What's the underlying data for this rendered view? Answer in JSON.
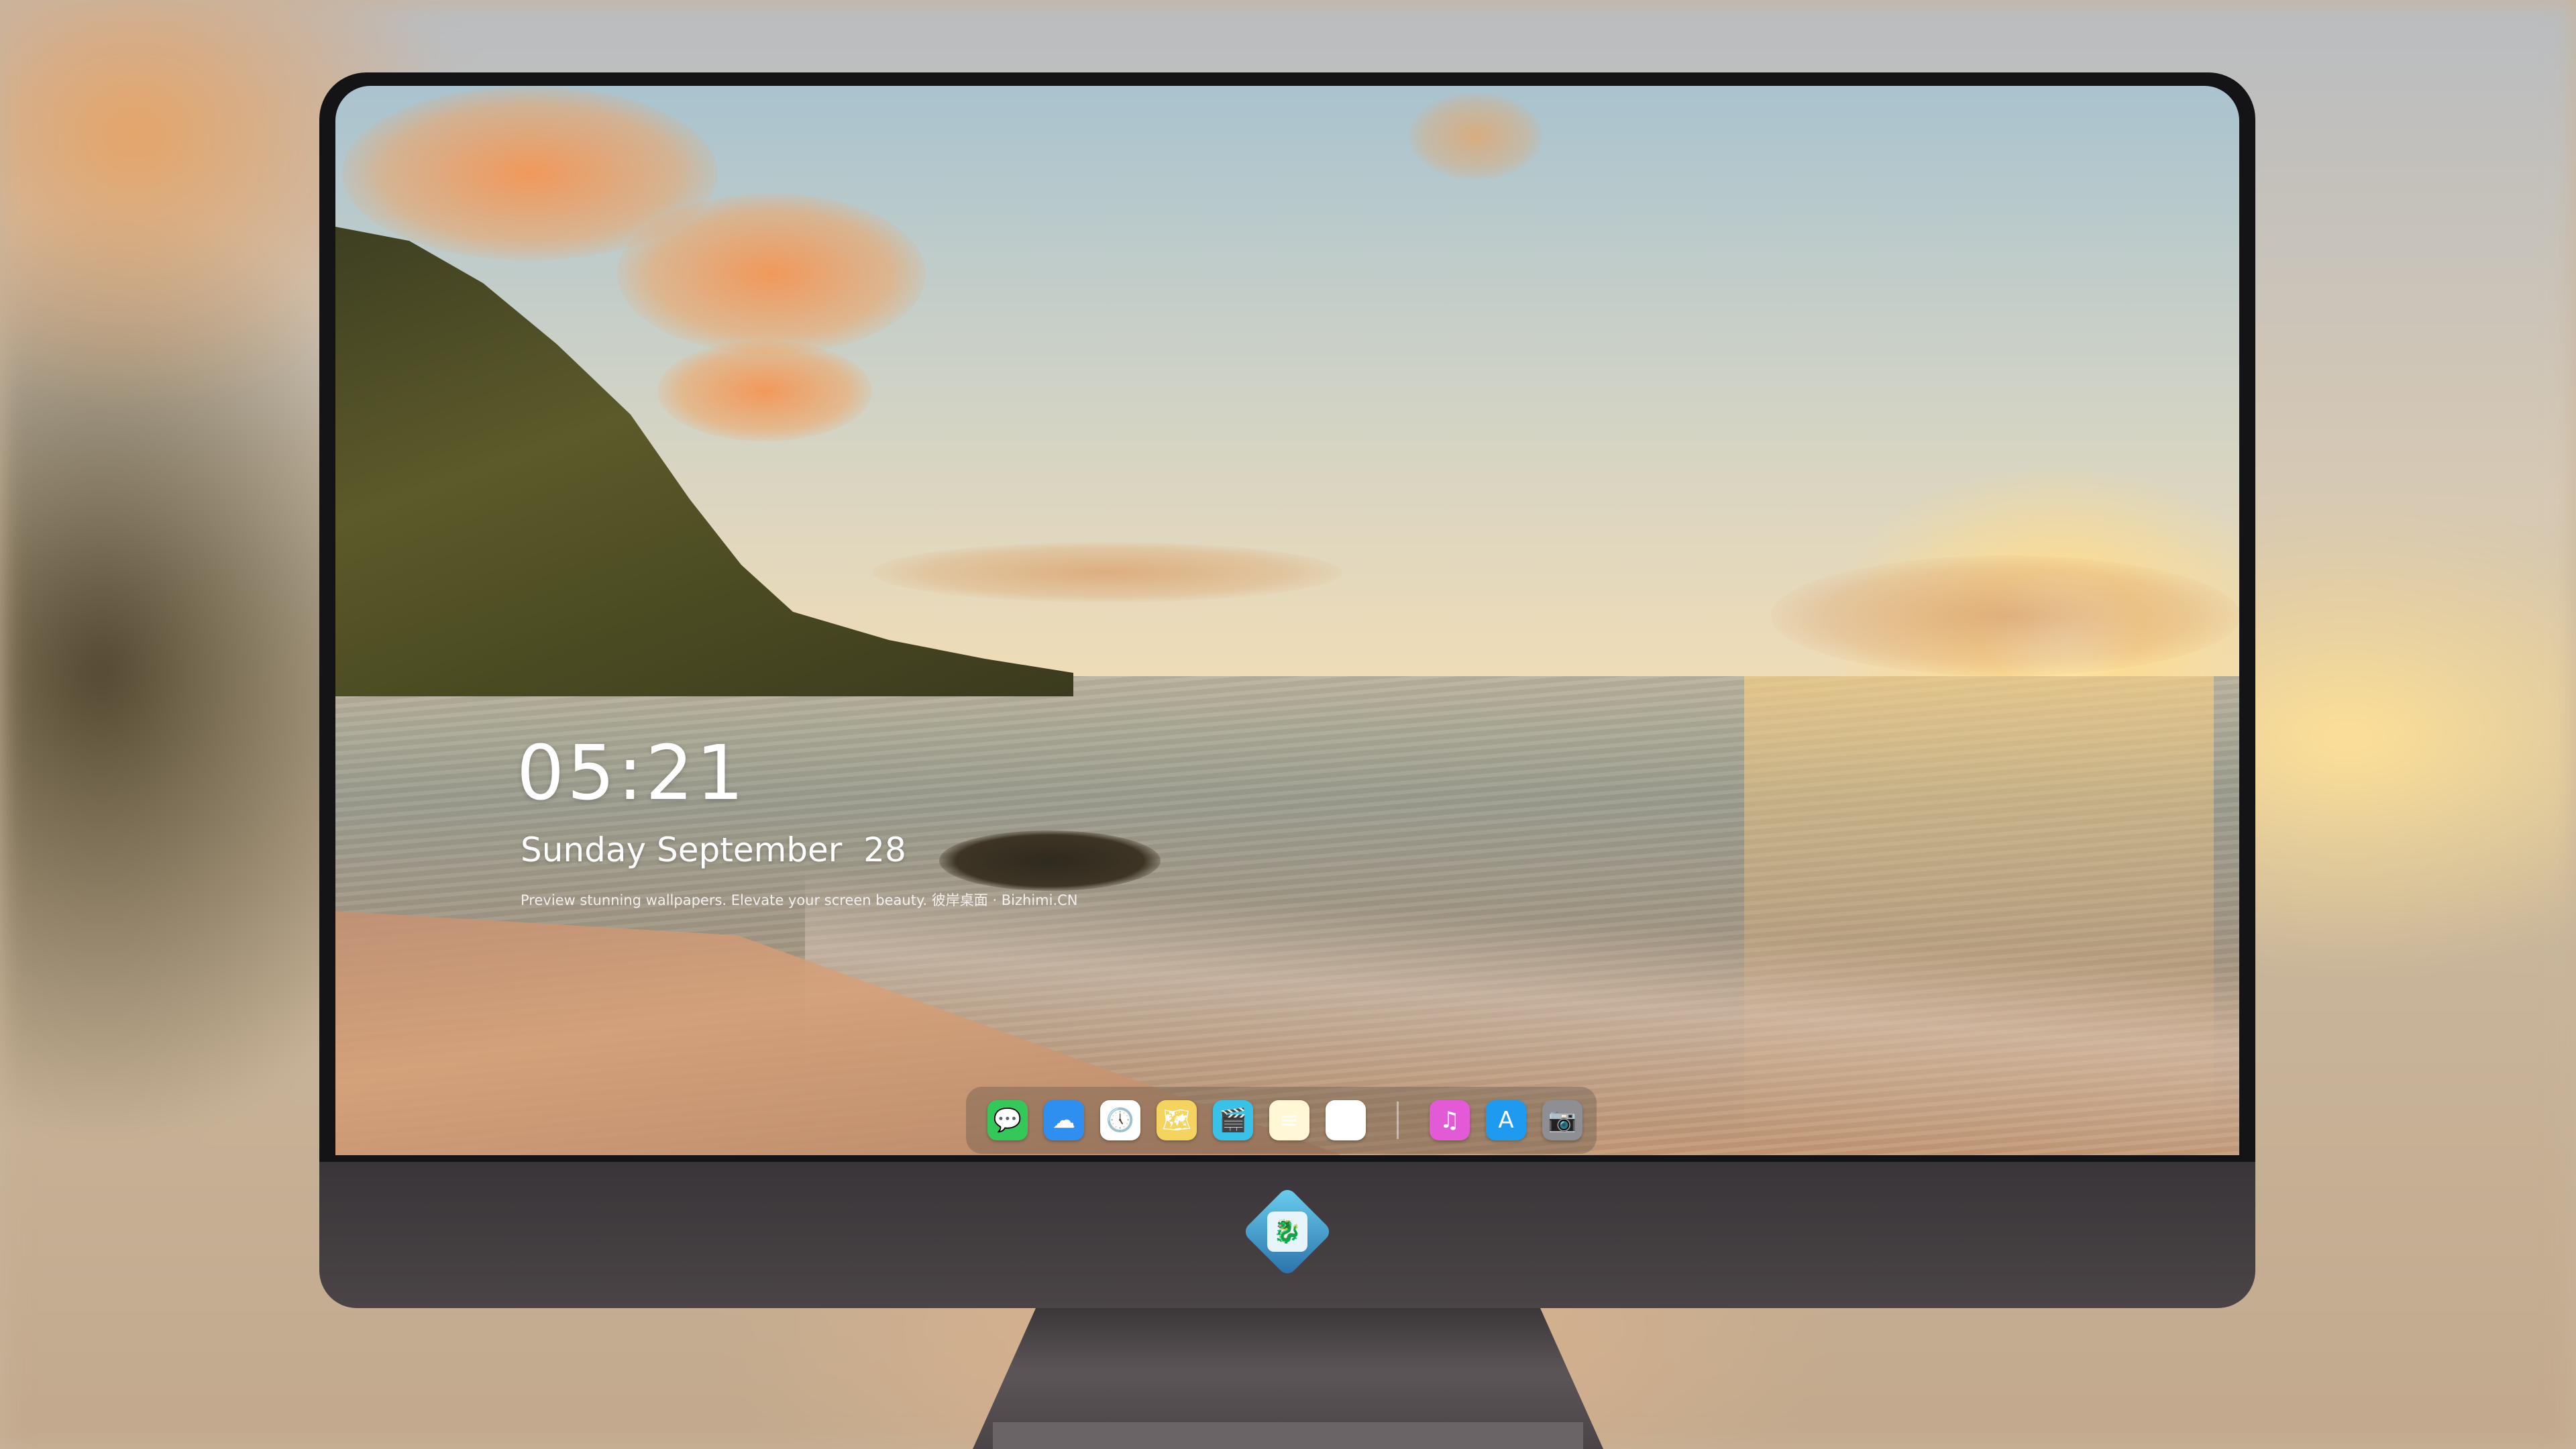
{
  "lockscreen": {
    "time": "05:21",
    "date": "Sunday September  28",
    "tagline": "Preview stunning wallpapers. Elevate your screen beauty. 彼岸桌面 · Bizhimi.CN"
  },
  "dock": {
    "apps": [
      {
        "name": "messages-icon",
        "glyph": "💬",
        "color": "#34c759"
      },
      {
        "name": "weather-icon",
        "glyph": "☁",
        "color": "#2f8ff0"
      },
      {
        "name": "clock-icon",
        "glyph": "🕔",
        "color": "#ffffff"
      },
      {
        "name": "maps-icon",
        "glyph": "🗺",
        "color": "#f4d35e"
      },
      {
        "name": "clips-icon",
        "glyph": "🎬",
        "color": "#39c2e8"
      },
      {
        "name": "notes-icon",
        "glyph": "≡",
        "color": "#fff7d6"
      },
      {
        "name": "photos-icon",
        "glyph": "🖼",
        "color": "#ffffff"
      },
      {
        "name": "music-icon",
        "glyph": "♫",
        "color": "#e35ad6"
      },
      {
        "name": "app-store-icon",
        "glyph": "A",
        "color": "#1e9bf0"
      },
      {
        "name": "camera-icon",
        "glyph": "📷",
        "color": "#8e8e93"
      }
    ]
  },
  "monitor": {
    "logo_glyph": "🐉"
  }
}
